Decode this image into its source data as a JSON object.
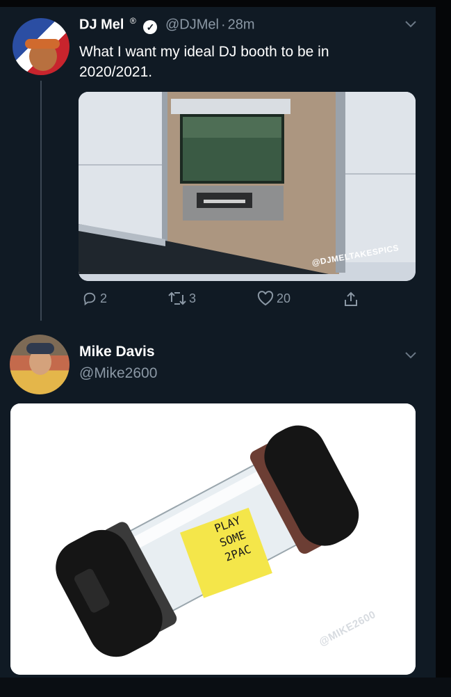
{
  "tweet1": {
    "name": "DJ Mel",
    "reg_mark": "®",
    "verified_mark": "✓",
    "handle": "@DJMel",
    "separator": "·",
    "time": "28m",
    "text": "What I want my ideal DJ booth to be in 2020/2021.",
    "image_watermark": "@DJMELTAKESPICS",
    "reply_count": "2",
    "retweet_count": "3",
    "like_count": "20"
  },
  "tweet2": {
    "name": "Mike Davis",
    "handle": "@Mike2600",
    "note_text": "PLAY SOME 2PAC",
    "note_lines": [
      "PLAY",
      "SOME",
      "2PAC"
    ],
    "image_watermark": "@MIKE2600"
  },
  "colors": {
    "background": "#101a24",
    "muted_text": "#8b98a5",
    "note_yellow": "#f4e64a"
  },
  "icons": {
    "menu": "chevron-down-icon",
    "reply": "reply-icon",
    "retweet": "retweet-icon",
    "like": "heart-icon",
    "share": "share-icon"
  }
}
